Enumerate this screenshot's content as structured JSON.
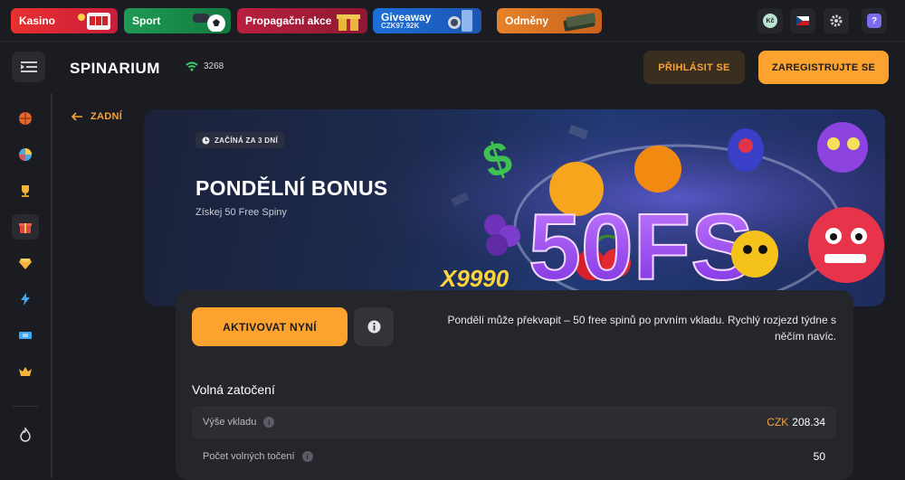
{
  "promos": {
    "kasino": "Kasino",
    "sport": "Sport",
    "propagacni": "Propagační akce",
    "giveaway": "Giveaway",
    "giveaway_amount": "CZK97.92K",
    "odmeny": "Odměny"
  },
  "topright": {
    "currency_badge": "Kč",
    "language": "CZ"
  },
  "header": {
    "logo": "SPINARIUM",
    "online_count": "3268",
    "login_label": "PŘIHLÁSIT SE",
    "register_label": "ZAREGISTRUJTE SE"
  },
  "back_label": "ZADNÍ",
  "banner": {
    "badge": "ZAČÍNÁ ZA 3 DNÍ",
    "title": "PONDĚLNÍ BONUS",
    "subtitle": "Získej 50 Free Spiny",
    "art_text": "50FS",
    "art_multiplier": "X9990"
  },
  "card": {
    "activate_label": "AKTIVOVAT NYNÍ",
    "description": "Pondělí může překvapit – 50 free spinů po prvním vkladu. Rychlý rozjezd týdne s něčím navíc.",
    "section_title": "Volná zatočení",
    "rows": [
      {
        "label": "Výše vkladu",
        "currency": "CZK",
        "value": "208.34"
      },
      {
        "label": "Počet volných točení",
        "value": "50"
      }
    ]
  },
  "colors": {
    "accent": "#fba22f",
    "background": "#1b1c21",
    "card": "#25262c"
  }
}
